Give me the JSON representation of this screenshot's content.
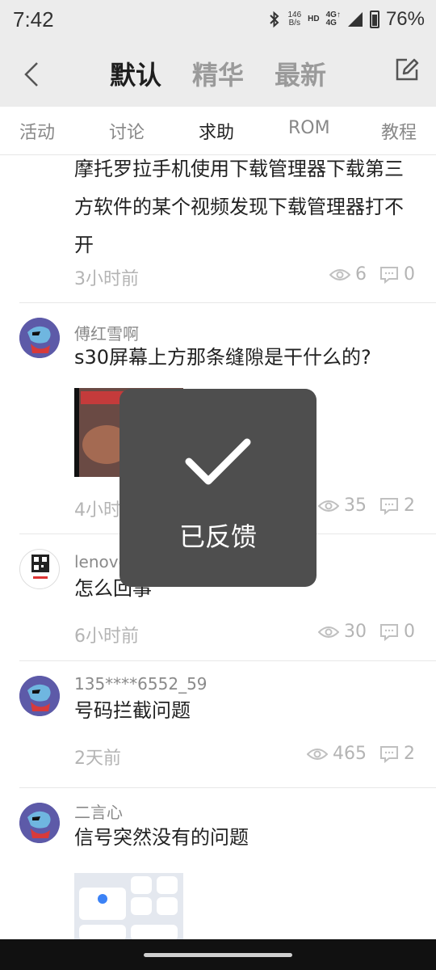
{
  "status": {
    "time": "7:42",
    "net_speed_value": "146",
    "net_speed_unit": "B/s",
    "net_hd": "HD",
    "net_type_top": "4G↑",
    "net_type_bottom": "4G",
    "battery": "76%"
  },
  "header": {
    "tabs": [
      "默认",
      "精华",
      "最新"
    ],
    "active_tab": 0
  },
  "categories": {
    "items": [
      "活动",
      "讨论",
      "求助",
      "ROM",
      "教程"
    ],
    "active": 2
  },
  "posts": [
    {
      "author": "",
      "title": "摩托罗拉手机使用下载管理器下载第三方软件的某个视频发现下载管理器打不开",
      "time": "3小时前",
      "views": "6",
      "comments": "0"
    },
    {
      "author": "傅红雪啊",
      "title": "s30屏幕上方那条缝隙是干什么的?",
      "time": "4小时前",
      "views": "35",
      "comments": "2"
    },
    {
      "author": "lenovo",
      "title": "怎么回事",
      "time": "6小时前",
      "views": "30",
      "comments": "0"
    },
    {
      "author": "135****6552_59",
      "title": "号码拦截问题",
      "time": "2天前",
      "views": "465",
      "comments": "2"
    },
    {
      "author": "二言心",
      "title": "信号突然没有的问题",
      "time": "",
      "views": "",
      "comments": ""
    }
  ],
  "toast": {
    "message": "已反馈"
  },
  "colors": {
    "accent": "#f08a1c",
    "header_bg": "#ececec",
    "toast_bg": "#4e4e4e"
  }
}
